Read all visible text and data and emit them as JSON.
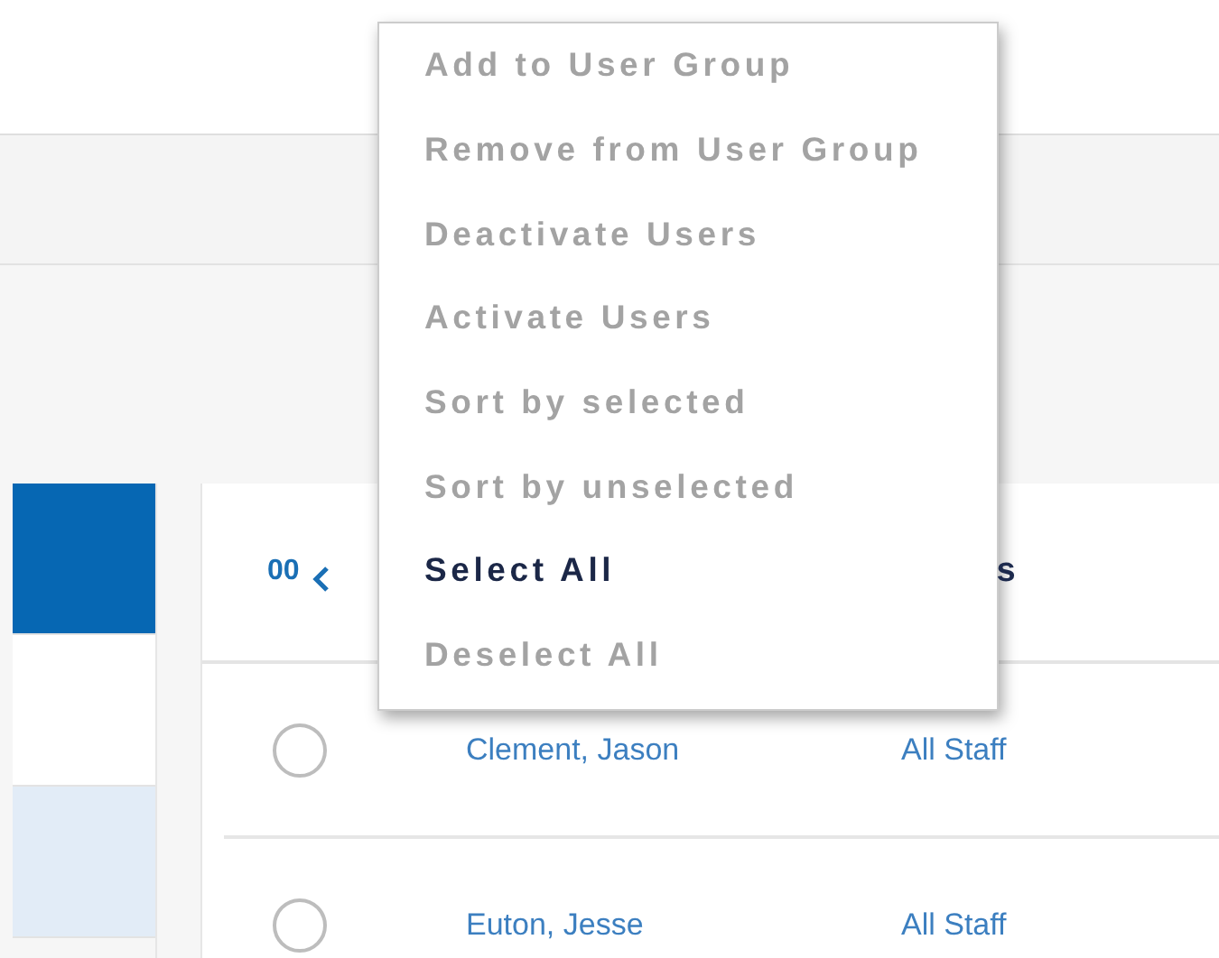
{
  "left_panel": {
    "items": [
      {
        "selected": true,
        "highlighted": false
      },
      {
        "selected": false,
        "highlighted": false
      },
      {
        "selected": false,
        "highlighted": true
      }
    ]
  },
  "table": {
    "header": {
      "pager_text": "00",
      "column_3_partial": "s"
    },
    "rows": [
      {
        "name": "Clement, Jason",
        "group": "All Staff",
        "selected": false
      },
      {
        "name": "Euton, Jesse",
        "group": "All Staff",
        "selected": false
      }
    ]
  },
  "menu": {
    "items": [
      {
        "label": "Add to User Group",
        "disabled": true
      },
      {
        "label": "Remove from User Group",
        "disabled": true
      },
      {
        "label": "Deactivate Users",
        "disabled": true
      },
      {
        "label": "Activate Users",
        "disabled": true
      },
      {
        "label": "Sort by selected",
        "disabled": true
      },
      {
        "label": "Sort by unselected",
        "disabled": true
      },
      {
        "label": "Select All",
        "disabled": false
      },
      {
        "label": "Deselect All",
        "disabled": true
      }
    ]
  }
}
